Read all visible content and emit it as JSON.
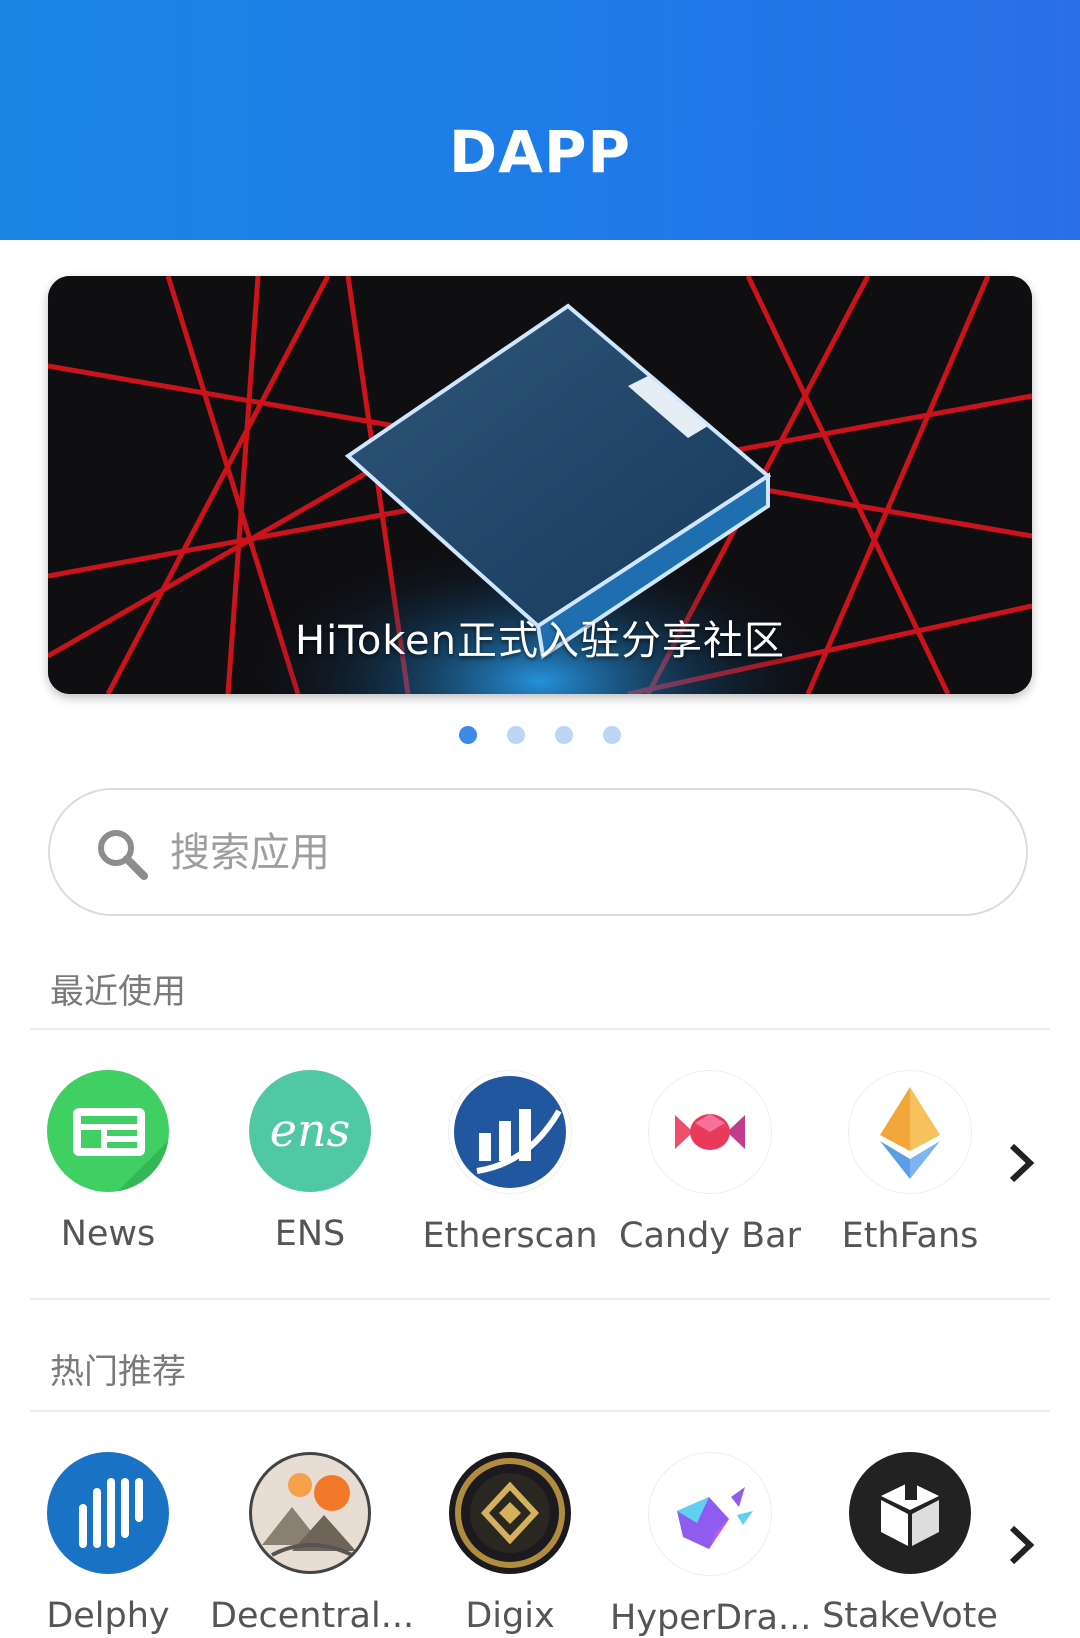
{
  "header": {
    "title": "DAPP"
  },
  "banner": {
    "caption": "HiToken正式入驻分享社区",
    "slides": 4,
    "active_slide": 1
  },
  "search": {
    "placeholder": "搜索应用",
    "value": ""
  },
  "recent": {
    "label": "最近使用",
    "apps": [
      {
        "name": "News",
        "icon": "news-icon",
        "color": "#3fcf63"
      },
      {
        "name": "ENS",
        "icon": "ens-icon",
        "color": "#4fc8a3"
      },
      {
        "name": "Etherscan",
        "icon": "etherscan-icon",
        "color": "#21579e"
      },
      {
        "name": "Candy Bar",
        "icon": "candy-bar-icon",
        "color": "#e83a5a"
      },
      {
        "name": "EthFans",
        "icon": "ethfans-icon",
        "color": "#f3a73a"
      }
    ]
  },
  "hot": {
    "label": "热门推荐",
    "apps": [
      {
        "name": "Delphy",
        "icon": "delphy-icon",
        "color": "#1a72c4"
      },
      {
        "name": "Decentral...",
        "icon": "decentraland-icon",
        "color": "#8a8072"
      },
      {
        "name": "Digix",
        "icon": "digix-icon",
        "color": "#b08d3e"
      },
      {
        "name": "HyperDra...",
        "icon": "hyperdragons-icon",
        "color": "#8f5cf0"
      },
      {
        "name": "StakeVote",
        "icon": "stakevote-icon",
        "color": "#222222"
      }
    ]
  }
}
